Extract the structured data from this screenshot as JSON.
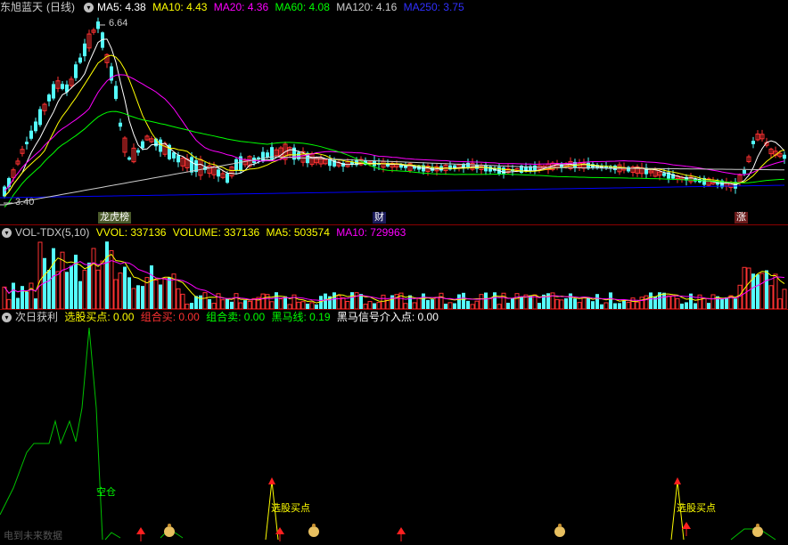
{
  "colors": {
    "up": "#ff3232",
    "down": "#54fcfc",
    "ma5": "#ffffff",
    "ma10": "#ffff00",
    "ma20": "#ff00ff",
    "ma60": "#00ff00",
    "ma120": "#cccccc",
    "ma250": "#0000ff",
    "sep": "#8b0000"
  },
  "price": {
    "stock": "东旭蓝天",
    "period": "(日线)",
    "toggle": "▾",
    "ma5_label": "MA5: 4.38",
    "ma10_label": "MA10: 4.43",
    "ma20_label": "MA20: 4.36",
    "ma60_label": "MA60: 4.08",
    "ma120_label": "MA120: 4.16",
    "ma250_label": "MA250: 3.75",
    "high_label": "6.64",
    "low_label": "3.40",
    "events": [
      "龙虎榜",
      "财",
      "涨"
    ]
  },
  "volume": {
    "title": "VOL-TDX(5,10)",
    "vvol": "VVOL: 337136",
    "volume": "VOLUME: 337136",
    "ma5": "MA5: 503574",
    "ma10": "MA10: 729963"
  },
  "indicator": {
    "title": "次日获利",
    "buy": "选股买点: 0.00",
    "combo_buy": "组合买: 0.00",
    "combo_sell": "组合卖: 0.00",
    "dark_horse": "黑马线: 0.19",
    "dark_horse_sig": "黑马信号介入点: 0.00",
    "empty_label": "空仓",
    "buy_point_1": "选股买点",
    "buy_point_2": "选股买点",
    "watermark": "电到未来数据"
  },
  "chart_data": {
    "type": "candlestick",
    "n_days": 176,
    "note_visible": "price range 3.40 - 6.64",
    "y_high": 6.64,
    "y_low": 3.4
  }
}
